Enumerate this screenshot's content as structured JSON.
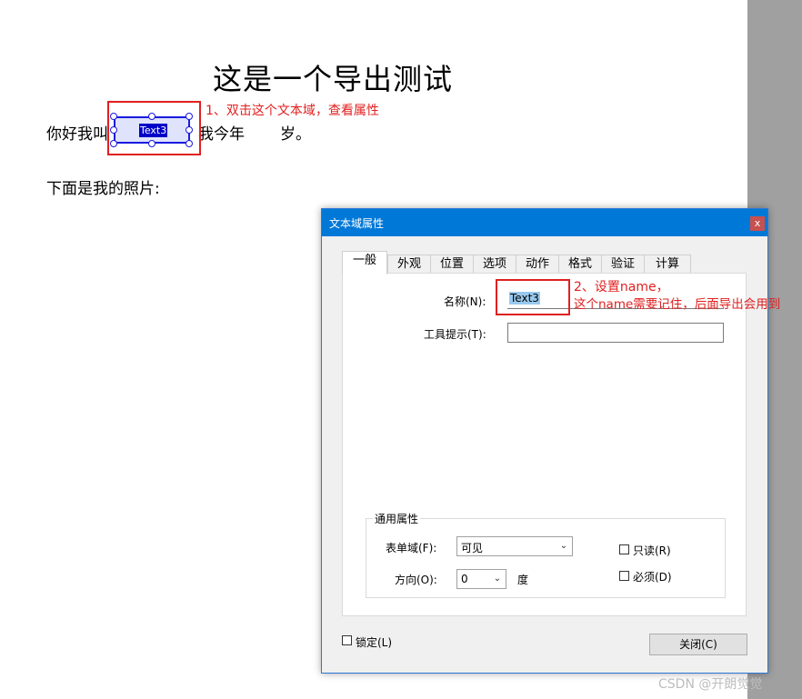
{
  "document": {
    "title": "这是一个导出测试",
    "line1_part1": "你好我叫",
    "line1_part2": "我今年",
    "line1_part3": "岁。",
    "line2": "下面是我的照片:",
    "field_widget_label": "Text3"
  },
  "annotations": {
    "step1": "1、双击这个文本域，查看属性",
    "step2_line1": "2、设置name，",
    "step2_line2": "这个name需要记住，后面导出会用到"
  },
  "dialog": {
    "title": "文本域属性",
    "close_glyph": "x",
    "tabs": [
      {
        "label": "一般",
        "active": true
      },
      {
        "label": "外观"
      },
      {
        "label": "位置"
      },
      {
        "label": "选项"
      },
      {
        "label": "动作"
      },
      {
        "label": "格式"
      },
      {
        "label": "验证"
      },
      {
        "label": "计算"
      }
    ],
    "name_label": "名称(N):",
    "name_value": "Text3",
    "tooltip_label": "工具提示(T):",
    "tooltip_value": "",
    "common_props": {
      "title": "通用属性",
      "form_field_label": "表单域(F):",
      "form_field_value": "可见",
      "orientation_label": "方向(O):",
      "orientation_value": "0",
      "degree_label": "度",
      "readonly_label": "只读(R)",
      "readonly_checked": false,
      "required_label": "必须(D)",
      "required_checked": false
    },
    "locked_label": "锁定(L)",
    "locked_checked": false,
    "close_button": "关闭(C)"
  },
  "watermark": "CSDN @开朗觉觉",
  "colors": {
    "annotation_red": "#e02020",
    "titlebar_blue": "#0078d7",
    "field_border_blue": "#1a1ae0"
  }
}
